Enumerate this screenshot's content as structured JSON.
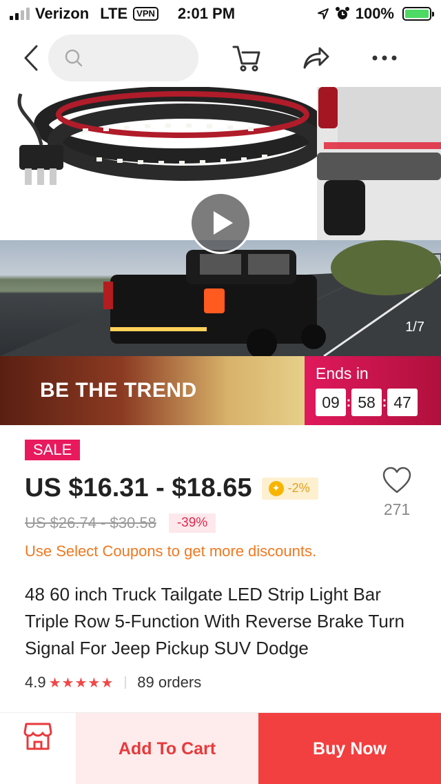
{
  "status_bar": {
    "carrier": "Verizon",
    "network": "LTE",
    "vpn": "VPN",
    "time": "2:01 PM",
    "battery": "100%"
  },
  "nav": {
    "icons": [
      "back-icon",
      "search-icon",
      "cart-icon",
      "share-icon",
      "more-icon"
    ]
  },
  "gallery": {
    "counter": "1/7"
  },
  "promo": {
    "title": "BE THE TREND",
    "ends_label": "Ends in",
    "hours": "09",
    "minutes": "58",
    "seconds": "47"
  },
  "product": {
    "sale_badge": "SALE",
    "price": "US $16.31 - $18.65",
    "coin_discount": "-2%",
    "original_price": "US $26.74 - $30.58",
    "discount": "-39%",
    "coupon_text": "Use Select Coupons to get more discounts.",
    "title": "48 60 inch Truck Tailgate LED Strip Light Bar Triple Row 5-Function With Reverse Brake Turn Signal For Jeep Pickup SUV Dodge",
    "rating": "4.9",
    "rating_stars": 5,
    "orders": "89 orders",
    "wishlist_count": "271"
  },
  "actions": {
    "add_to_cart": "Add To Cart",
    "buy_now": "Buy Now"
  },
  "colors": {
    "accent": "#f23f3f",
    "sale": "#e8195d",
    "coupon": "#f07820"
  }
}
